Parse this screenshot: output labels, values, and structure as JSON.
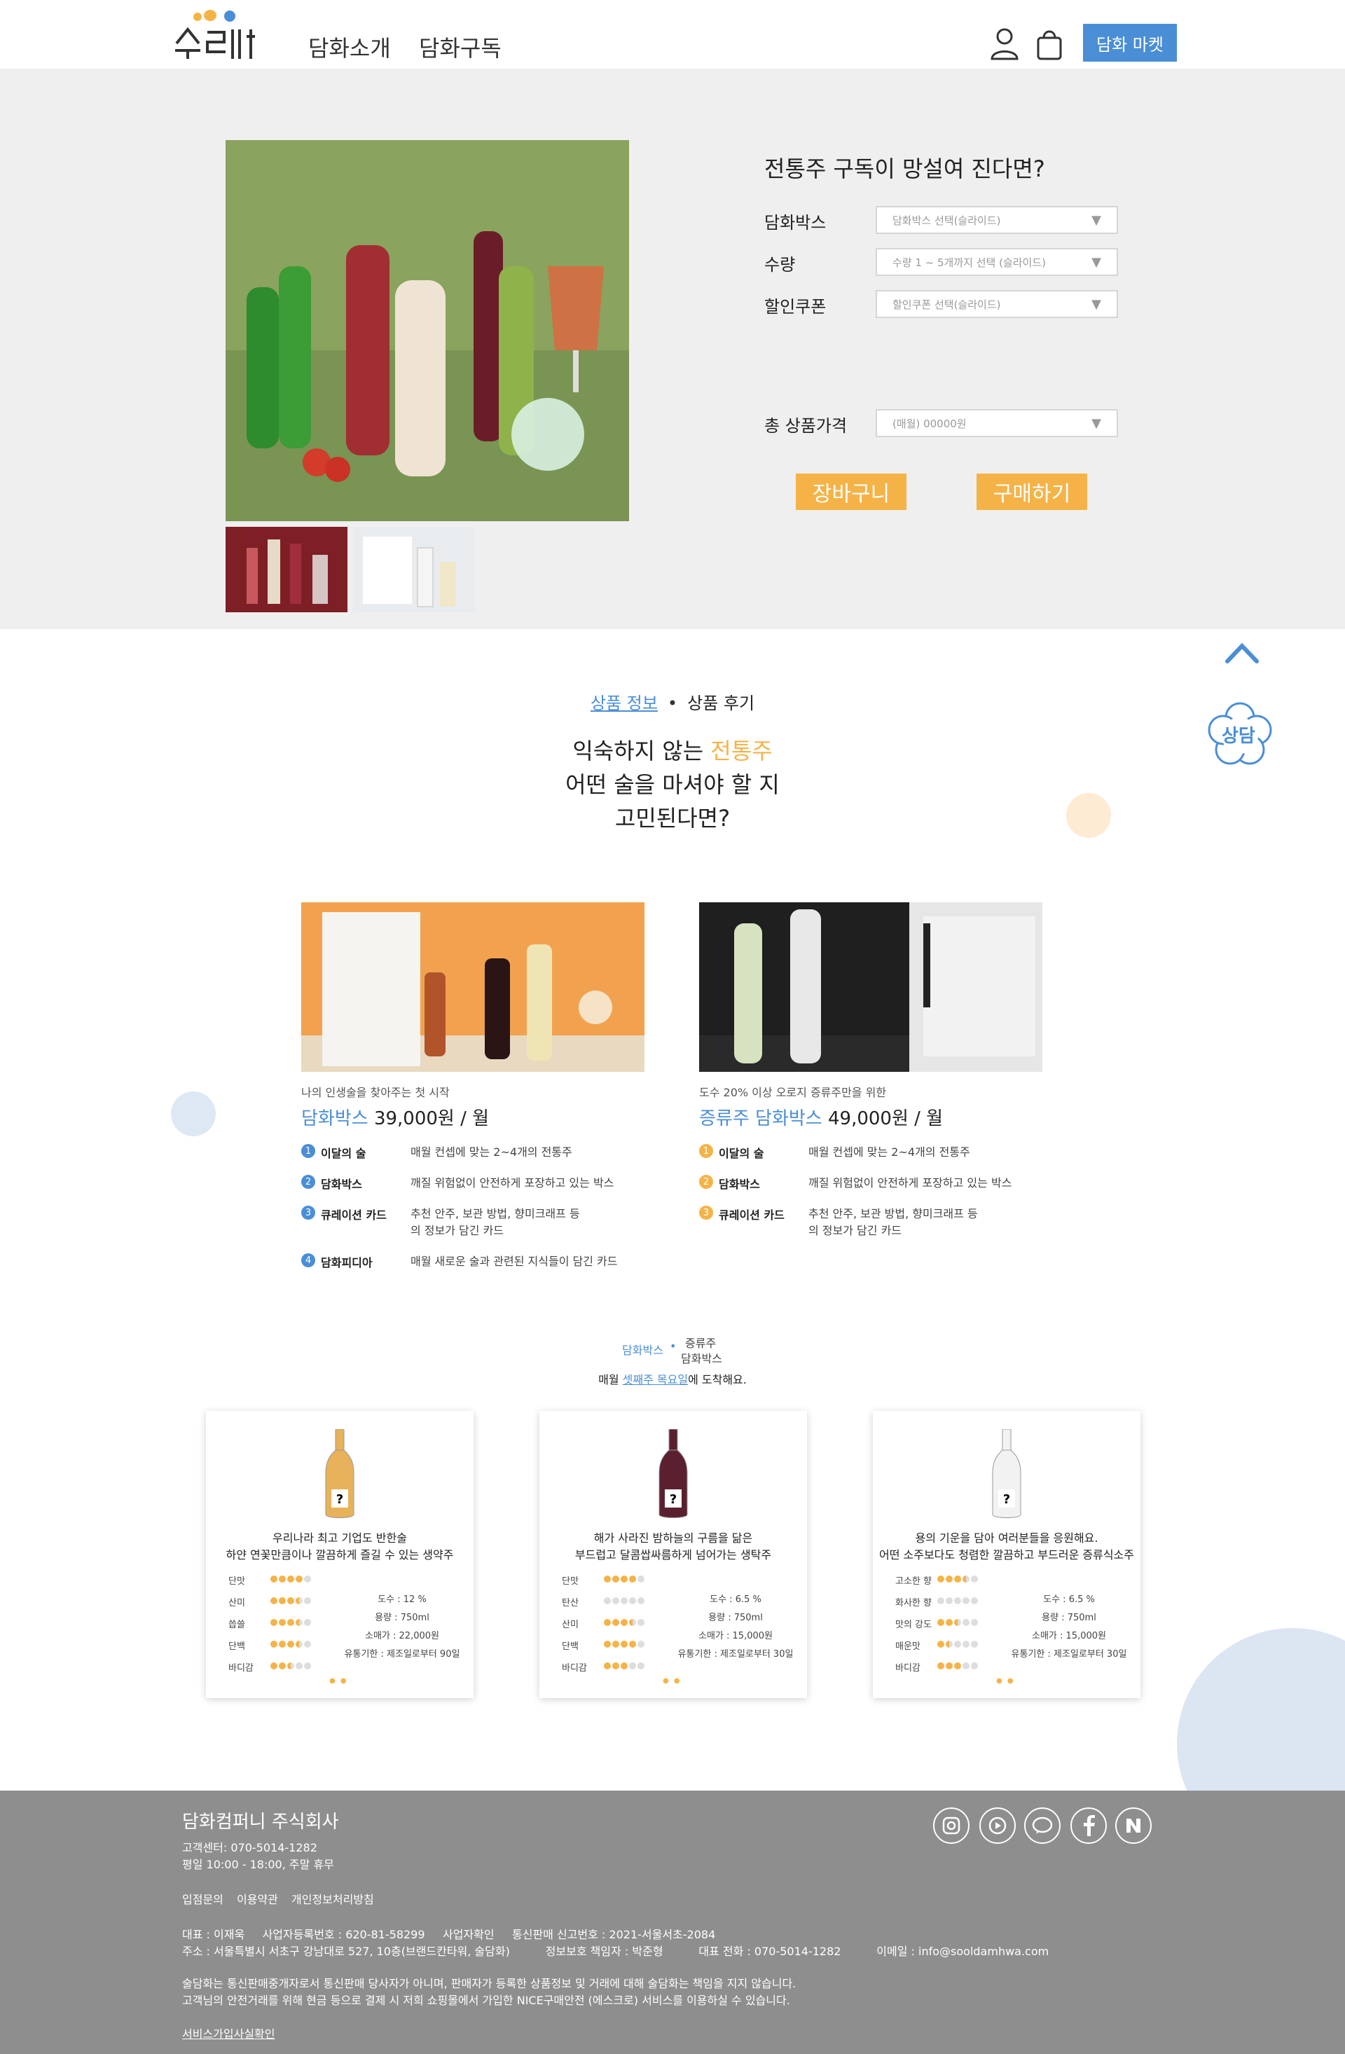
{
  "header": {
    "nav": [
      "담화소개",
      "담화구독"
    ],
    "market_button": "담화 마켓"
  },
  "product": {
    "title": "전통주 구독이 망설여 진다면?",
    "options": [
      {
        "label": "담화박스",
        "placeholder": "담화박스 선택(슬라이드)"
      },
      {
        "label": "수량",
        "placeholder": "수량 1 ~ 5개까지 선택 (슬라이드)"
      },
      {
        "label": "할인쿠폰",
        "placeholder": "할인쿠폰 선택(슬라이드)"
      }
    ],
    "total_label": "총 상품가격",
    "total_value": "(매월) 00000원",
    "cart_button": "장바구니",
    "buy_button": "구매하기"
  },
  "floating": {
    "consult": "상담"
  },
  "tabs": {
    "info": "상품 정보",
    "review": "상품 후기"
  },
  "headline": {
    "line1_pre": "익숙하지 않는 ",
    "line1_highlight": "전통주",
    "line2": "어떤 술을 마셔야 할 지",
    "line3": "고민된다면?"
  },
  "boxes": [
    {
      "subtitle": "나의 인생술을 찾아주는 첫 시작",
      "name": "담화박스",
      "price": " 39,000원 / 월",
      "accent": "#4a8ed6",
      "features": [
        {
          "num": "1",
          "name": "이달의 술",
          "desc": "매월 컨셉에 맞는 2~4개의 전통주"
        },
        {
          "num": "2",
          "name": "담화박스",
          "desc": "깨질 위험없이 안전하게 포장하고 있는 박스"
        },
        {
          "num": "3",
          "name": "큐레이션 카드",
          "desc": "추천 안주, 보관 방법, 향미크래프 등의 정보가 담긴 카드"
        },
        {
          "num": "4",
          "name": "담화피디아",
          "desc": "매월 새로운 술과 관련된 지식들이 담긴 카드"
        }
      ]
    },
    {
      "subtitle": "도수 20% 이상 오로지 증류주만을 위한",
      "name": "증류주 담화박스",
      "price": " 49,000원 / 월",
      "accent": "#f5b347",
      "features": [
        {
          "num": "1",
          "name": "이달의 술",
          "desc": "매월 컨셉에 맞는 2~4개의 전통주"
        },
        {
          "num": "2",
          "name": "담화박스",
          "desc": "깨질 위험없이 안전하게 포장하고 있는 박스"
        },
        {
          "num": "3",
          "name": "큐레이션 카드",
          "desc": "추천 안주, 보관 방법, 향미크래프 등의 정보가 담긴 카드"
        }
      ]
    }
  ],
  "selector": {
    "a": "담화박스",
    "b": "증류주",
    "c": "담화박스"
  },
  "arrival": {
    "pre": "매월 ",
    "em": "셋째주 목요일",
    "post": "에 도착해요."
  },
  "bottles": [
    {
      "desc1": "우리나라 최고 기업도 반한술",
      "desc2": "하얀 연꽃만큼이나 깔끔하게 즐길 수 있는 생약주",
      "bottle_color": "#e8b25a",
      "ratings": [
        {
          "label": "단맛",
          "value": 4
        },
        {
          "label": "산미",
          "value": 3.5
        },
        {
          "label": "씁쓸",
          "value": 3.5
        },
        {
          "label": "단백",
          "value": 3.5
        },
        {
          "label": "바디감",
          "value": 2.5
        }
      ],
      "specs": [
        "도수 : 12 %",
        "용량 : 750ml",
        "소매가 : 22,000원",
        "유통기한 : 제조일로부터 90일"
      ]
    },
    {
      "desc1": "해가 사라진 밤하늘의 구름을 닮은",
      "desc2": "부드럽고 달콤쌉싸름하게 넘어가는 생탁주",
      "bottle_color": "#5a2030",
      "ratings": [
        {
          "label": "단맛",
          "value": 4
        },
        {
          "label": "탄산",
          "value": 0
        },
        {
          "label": "산미",
          "value": 3.5
        },
        {
          "label": "단백",
          "value": 4
        },
        {
          "label": "바디감",
          "value": 3
        }
      ],
      "specs": [
        "도수 : 6.5 %",
        "용량 : 750ml",
        "소매가 : 15,000원",
        "유통기한 : 제조일로부터 30일"
      ]
    },
    {
      "desc1": "용의 기운을 담아 여러분들을 응원해요.",
      "desc2": "어떤 소주보다도 청렴한 깔끔하고 부드러운 증류식소주",
      "bottle_color": "#f2f2f2",
      "ratings": [
        {
          "label": "고소한 향",
          "value": 3.5
        },
        {
          "label": "화사한 향",
          "value": 0
        },
        {
          "label": "맛의 강도",
          "value": 2.5
        },
        {
          "label": "매운맛",
          "value": 1.5
        },
        {
          "label": "바디감",
          "value": 3
        }
      ],
      "specs": [
        "도수 : 6.5 %",
        "용량 : 750ml",
        "소매가 : 15,000원",
        "유통기한 : 제조일로부터 30일"
      ]
    }
  ],
  "footer": {
    "company": "담화컴퍼니 주식회사",
    "cs_phone": "고객센터: 070-5014-1282",
    "cs_hours": "평일 10:00 - 18:00, 주말 휴무",
    "links": [
      "입점문의",
      "이용약관",
      "개인정보처리방침"
    ],
    "biz_line1": "대표 : 이재욱     사업자등록번호 : 620-81-58299     사업자확인     통신판매 신고번호 : 2021-서울서초-2084",
    "biz_line2": "주소 : 서울특별시 서초구 강남대로 527, 10층(브랜드칸타워, 술담화)          정보보호 책임자 : 박준형          대표 전화 : 070-5014-1282          이메일 : info@sooldamhwa.com",
    "notice1": "술담화는 통신판매중개자로서 통신판매 당사자가 아니며, 판매자가 등록한 상품정보 및 거래에 대해 술담화는 책임을 지지 않습니다.",
    "notice2": "고객님의 안전거래를 위해 현금 등으로 결제 시 저희 쇼핑몰에서 가입한 NICE구매안전 (에스크로) 서비스를 이용하실 수 있습니다.",
    "service_link": "서비스가입사실확인",
    "sns": [
      "instagram-icon",
      "youtube-icon",
      "kakaotalk-icon",
      "facebook-icon",
      "naver-icon"
    ]
  }
}
